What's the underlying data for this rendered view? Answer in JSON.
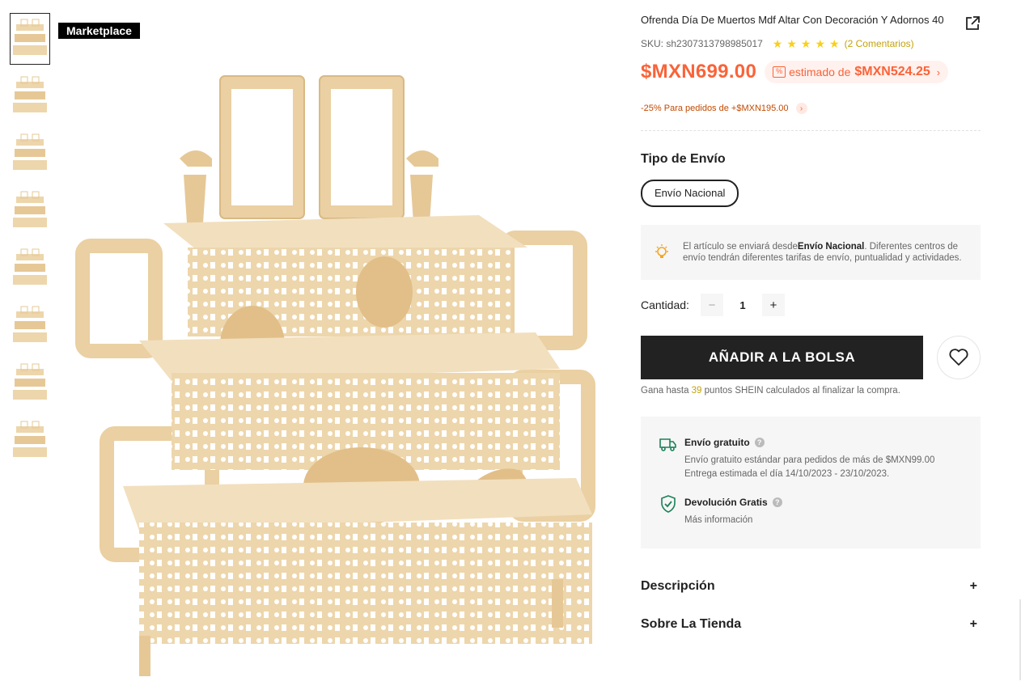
{
  "badge": "Marketplace",
  "thumbnails_count": 8,
  "product": {
    "title": "Ofrenda Día De Muertos Mdf Altar Con Decoración Y Adornos 40",
    "sku": "SKU: sh2307313798985017",
    "rating": 5,
    "reviews": "(2 Comentarios)",
    "price": "$MXN699.00",
    "estimated_label": "estimado de",
    "estimated_price": "$MXN524.25",
    "promo": "-25% Para pedidos de +$MXN195.00"
  },
  "shipping": {
    "section_title": "Tipo de Envío",
    "option": "Envío Nacional",
    "note_prefix": "El artículo se enviará desde",
    "note_bold": "Envío Nacional",
    "note_suffix": ". Diferentes centros de envío tendrán diferentes tarifas de envío, puntualidad y actividades."
  },
  "quantity": {
    "label": "Cantidad:",
    "value": "1",
    "minus": "−",
    "plus": "+"
  },
  "cart": {
    "add_label": "AÑADIR A LA BOLSA",
    "points_prefix": "Gana hasta ",
    "points_value": "39",
    "points_suffix": " puntos SHEIN calculados al finalizar la compra."
  },
  "services": {
    "free_shipping_title": "Envío gratuito",
    "free_shipping_line1": "Envío gratuito estándar para pedidos de más de $MXN99.00",
    "free_shipping_line2": "Entrega estimada el día 14/10/2023 - 23/10/2023.",
    "return_title": "Devolución Gratis",
    "return_link": "Más información"
  },
  "accordions": {
    "description": "Descripción",
    "store": "Sobre La Tienda",
    "toggle": "+"
  },
  "colors": {
    "price": "#FA6338",
    "star": "#FACF19",
    "button": "#222222",
    "panel": "#F6F6F6",
    "wood": "#EBD2A6"
  }
}
